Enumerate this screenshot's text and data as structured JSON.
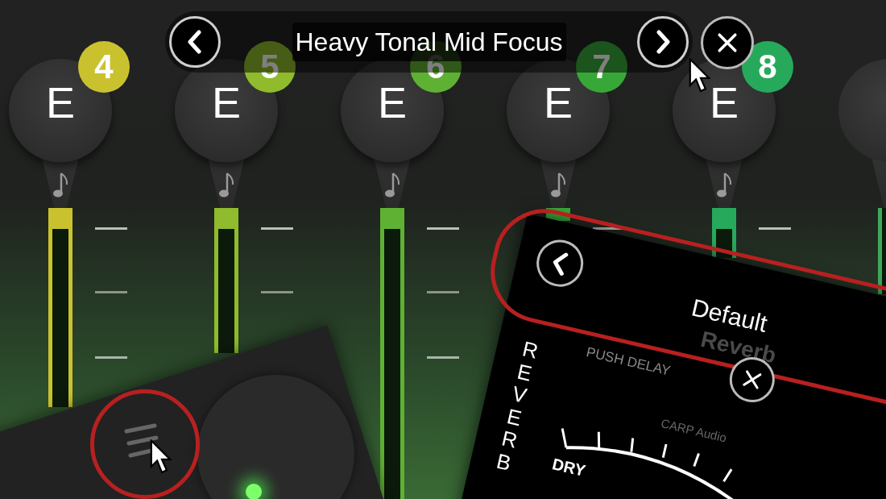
{
  "preset_bar": {
    "title": "Heavy Tonal Mid Focus"
  },
  "strings": [
    {
      "note": "E",
      "number": "4",
      "color": "#c9c22e"
    },
    {
      "note": "E",
      "number": "5",
      "color": "#8fbb2c"
    },
    {
      "note": "E",
      "number": "6",
      "color": "#5fb133"
    },
    {
      "note": "E",
      "number": "7",
      "color": "#37a838"
    },
    {
      "note": "E",
      "number": "8",
      "color": "#27a95b"
    }
  ],
  "reverb_panel": {
    "preset": "Default",
    "ghost_title": "Reverb",
    "push_label": "PUSH DELAY",
    "logo": "CARP Audio",
    "side_label": "REVERB",
    "dial_label": "DRY"
  }
}
